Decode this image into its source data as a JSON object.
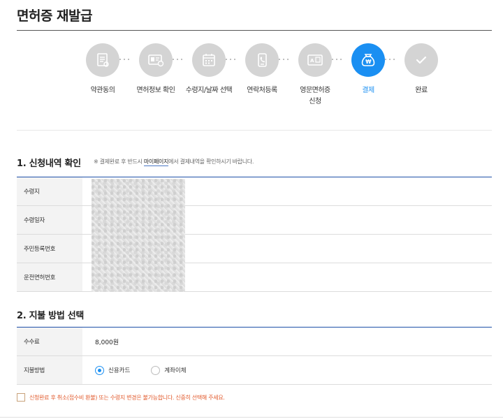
{
  "page": {
    "title": "면허증 재발급"
  },
  "steps": [
    {
      "label": "약관동의",
      "icon": "document-icon",
      "state": "done"
    },
    {
      "label": "면허정보 확인",
      "icon": "license-card-icon",
      "state": "done"
    },
    {
      "label": "수령지/날짜 선택",
      "icon": "calendar-icon",
      "state": "done"
    },
    {
      "label": "연락처등록",
      "icon": "phone-icon",
      "state": "done"
    },
    {
      "label": "영문면허증\n신청",
      "icon": "english-license-icon",
      "state": "done"
    },
    {
      "label": "결제",
      "icon": "payment-bag-icon",
      "state": "active"
    },
    {
      "label": "완료",
      "icon": "check-icon",
      "state": "pending"
    }
  ],
  "section1": {
    "title": "1. 신청내역 확인",
    "note_prefix": "※ 결제완료 후 반드시 ",
    "note_link": "마이페이지",
    "note_suffix": "에서 결제내역을 확인하시기 바랍니다.",
    "rows": [
      {
        "label": "수령지",
        "value": ""
      },
      {
        "label": "수령일자",
        "value": ""
      },
      {
        "label": "주민등록번호",
        "value": ""
      },
      {
        "label": "운전면허번호",
        "value": ""
      }
    ]
  },
  "section2": {
    "title": "2. 지불 방법 선택",
    "fee_label": "수수료",
    "fee_value": "8,000원",
    "method_label": "지불방법",
    "methods": [
      {
        "label": "신용카드",
        "selected": true
      },
      {
        "label": "계좌이체",
        "selected": false
      }
    ]
  },
  "agreement": {
    "text": "신청완료 후 취소(접수비 환불) 또는 수령지 변경은 불가능합니다. 신중히 선택해 주세요.",
    "checked": false
  },
  "colors": {
    "accent": "#1a8ff2",
    "inactive_step": "#d4d4d4",
    "table_border": "#1d4fa8",
    "warning": "#e25a2c"
  }
}
